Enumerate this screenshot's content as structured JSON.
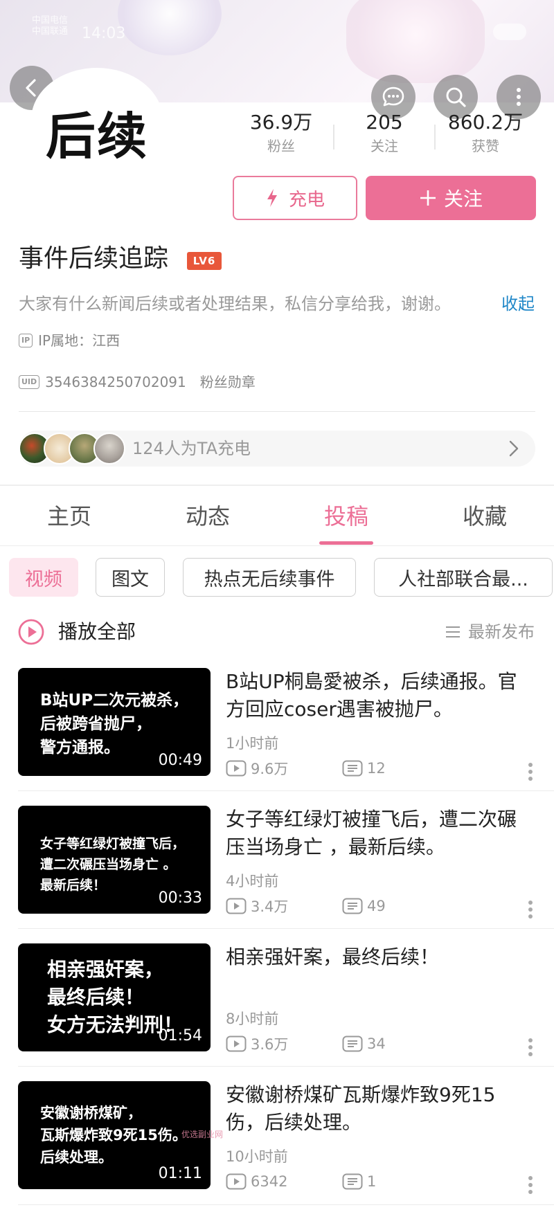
{
  "status_bar": {
    "carrier_line1": "中国电信",
    "carrier_line2": "中国联通",
    "time": "14:03"
  },
  "header": {
    "avatar_text": "后续",
    "buttons": {
      "back": "chevron-left-icon",
      "message": "chat-bubble-icon",
      "search": "search-icon",
      "more": "vertical-dots-icon"
    }
  },
  "stats": [
    {
      "value": "36.9万",
      "label": "粉丝"
    },
    {
      "value": "205",
      "label": "关注"
    },
    {
      "value": "860.2万",
      "label": "获赞"
    }
  ],
  "actions": {
    "charge_label": "充电",
    "follow_label": "关注"
  },
  "profile": {
    "name": "事件后续追踪",
    "level": "LV6",
    "bio": "大家有什么新闻后续或者处理结果，私信分享给我，谢谢。",
    "collapse_label": "收起",
    "ip_tag": "IP",
    "ip_location": "IP属地：江西",
    "uid_tag": "UID",
    "uid": "3546384250702091",
    "fan_badge_label": "粉丝勋章"
  },
  "chargers": {
    "text": "124人为TA充电"
  },
  "tabs": [
    {
      "label": "主页",
      "active": false
    },
    {
      "label": "动态",
      "active": false
    },
    {
      "label": "投稿",
      "active": true
    },
    {
      "label": "收藏",
      "active": false
    }
  ],
  "chips": [
    {
      "label": "视频",
      "active": true
    },
    {
      "label": "图文",
      "active": false
    },
    {
      "label": "热点无后续事件",
      "active": false
    },
    {
      "label": "人社部联合最...",
      "active": false
    }
  ],
  "list_header": {
    "play_all_label": "播放全部",
    "sort_label": "最新发布"
  },
  "videos": [
    {
      "thumb_text": "B站UP二次元被杀，\n后被跨省抛尸，\n警方通报。",
      "duration": "00:49",
      "title": "B站UP桐島愛被杀，后续通报。官方回应coser遇害被抛尸。",
      "time": "1小时前",
      "views": "9.6万",
      "comments": "12"
    },
    {
      "thumb_text": "女子等红绿灯被撞飞后，\n遭二次碾压当场身亡 。\n最新后续！",
      "duration": "00:33",
      "title": "女子等红绿灯被撞飞后，遭二次碾压当场身亡 ，最新后续。",
      "time": "4小时前",
      "views": "3.4万",
      "comments": "49"
    },
    {
      "thumb_text": "相亲强奸案，\n最终后续！\n女方无法判刑！",
      "duration": "01:54",
      "title": "相亲强奸案，最终后续！",
      "time": "8小时前",
      "views": "3.6万",
      "comments": "34"
    },
    {
      "thumb_text": "安徽谢桥煤矿，\n瓦斯爆炸致9死15伤。\n后续处理。",
      "duration": "01:11",
      "title": "安徽谢桥煤矿瓦斯爆炸致9死15伤，后续处理。",
      "time": "10小时前",
      "views": "6342",
      "comments": "1"
    }
  ],
  "watermark": "优选副业网",
  "colors": {
    "accent": "#ec6f96",
    "link": "#1f87c8",
    "level_badge": "#e8573a"
  }
}
